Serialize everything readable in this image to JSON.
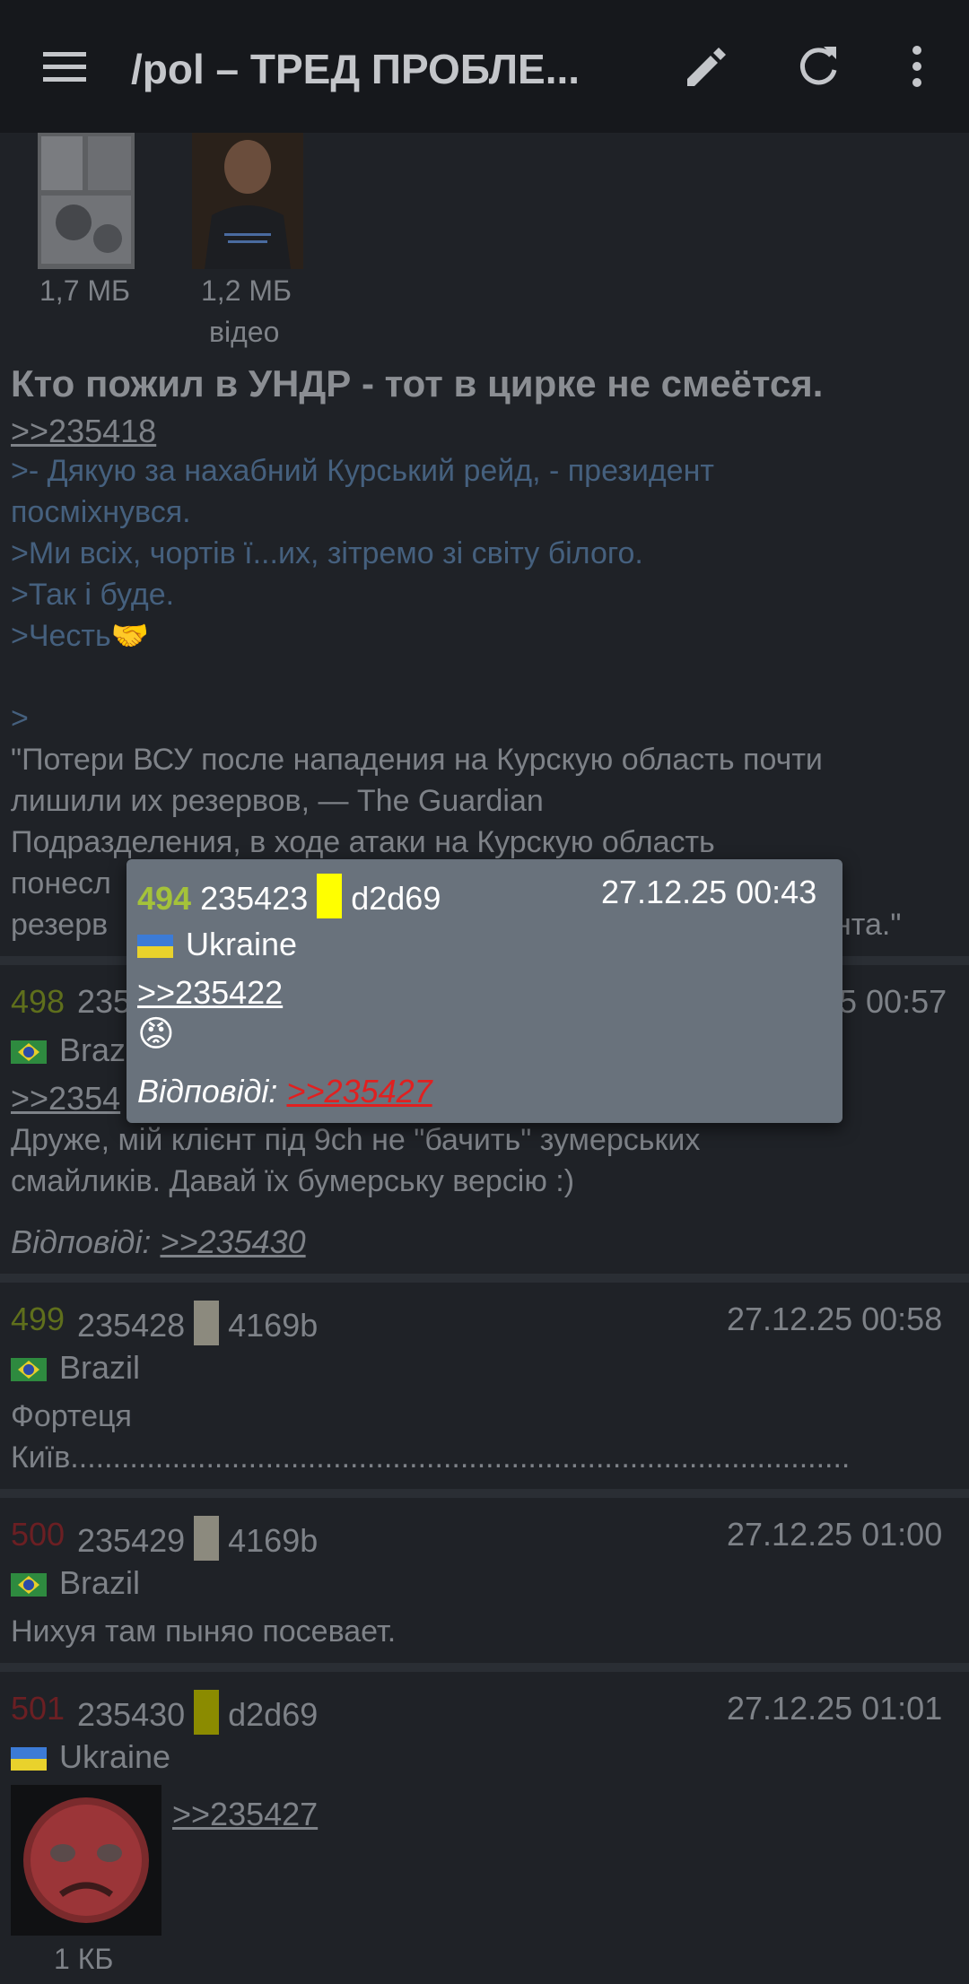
{
  "app": {
    "title": "/pol – ТРЕД ПРОБЛЕ...",
    "icons": [
      "menu-icon",
      "edit-icon",
      "refresh-icon",
      "more-vert-icon"
    ]
  },
  "op": {
    "files": [
      {
        "size": "1,7 МБ",
        "type": ""
      },
      {
        "size": "1,2 МБ",
        "type": "відео"
      }
    ],
    "subject": "Кто пожил в УНДР - тот в цирке не смеётся.",
    "ref": ">>235418",
    "quote1": ">- Дякую за нахабний Курський рейд, - президент",
    "quote1b": "посміхнувся.",
    "quote2": ">Ми всіх, чортів ї...их, зітремо зі світу білого.",
    "quote3": ">Так і буде.",
    "quote4": ">Честь🤝",
    "quote5": ">",
    "body1": "\"Потери ВСУ после нападения на Курскую область почти",
    "body2": "лишили их резервов, — The Guardian",
    "body3": "Подразделения, в ходе атаки на Курскую область",
    "body4": "понесл",
    "body5": "резерв",
    "body5_tail": "нта.\""
  },
  "post498": {
    "num": "498",
    "id": "235",
    "time": "5 00:57",
    "country": "Braz",
    "ref": ">>2354",
    "text1": "Друже, мій клієнт під 9ch не \"бачить\" зумерських",
    "text2": "смайликів. Давай їх бумерську версію :)",
    "replies_label": "Відповіді:",
    "replies_link": ">>235430"
  },
  "post499": {
    "num": "499",
    "id": "235428",
    "uid": "4169b",
    "time": "27.12.25 00:58",
    "country": "Brazil",
    "text1": "Фортеця",
    "text2": "Київ............................................................................................"
  },
  "post500": {
    "num": "500",
    "id": "235429",
    "uid": "4169b",
    "time": "27.12.25 01:00",
    "country": "Brazil",
    "text1": "Нихуя там пыняо посевает."
  },
  "post501": {
    "num": "501",
    "id": "235430",
    "uid": "d2d69",
    "time": "27.12.25 01:01",
    "country": "Ukraine",
    "ref": ">>235427",
    "file_size": "1 КБ"
  },
  "popup": {
    "num": "494",
    "id": "235423",
    "uid": "d2d69",
    "time": "27.12.25 00:43",
    "country": "Ukraine",
    "ref": ">>235422",
    "emoji": "😡",
    "replies_label": "Відповіді:",
    "replies_link": ">>235427"
  },
  "colors": {
    "id_yellow": "#ffff00",
    "id_olive": "#8b8b00",
    "id_grey": "#8c8a7e",
    "num_green": "#a4c23a",
    "reply_red": "#e02020"
  }
}
